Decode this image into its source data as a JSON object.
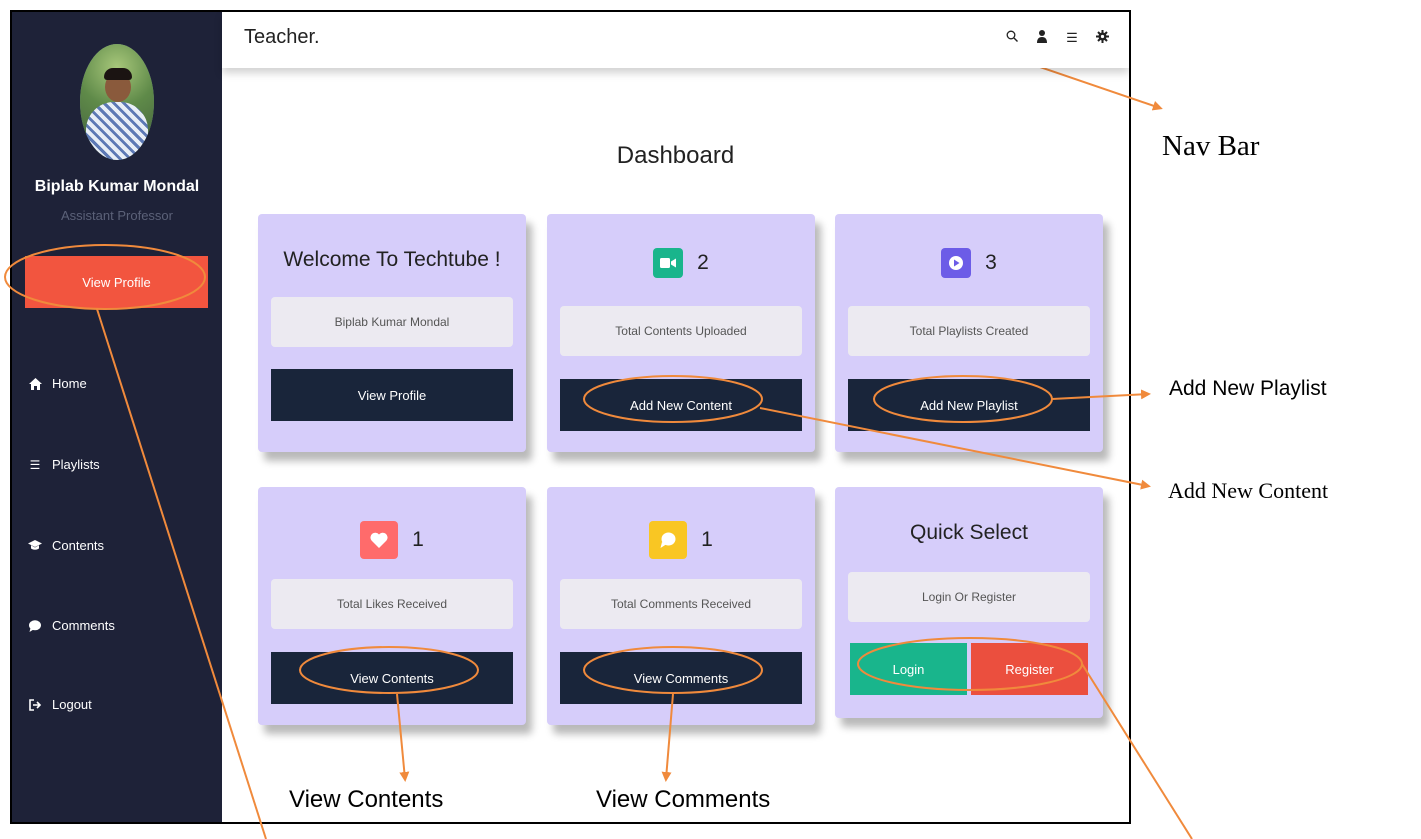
{
  "app": {
    "brand": "Teacher.",
    "page_title": "Dashboard",
    "profile": {
      "name": "Biplab Kumar Mondal",
      "role": "Assistant Professor",
      "button": "View Profile"
    },
    "sidebar": {
      "items": [
        {
          "label": "Home",
          "icon": "home-icon"
        },
        {
          "label": "Playlists",
          "icon": "list-icon"
        },
        {
          "label": "Contents",
          "icon": "graduation-cap-icon"
        },
        {
          "label": "Comments",
          "icon": "comment-icon"
        },
        {
          "label": "Logout",
          "icon": "logout-icon"
        }
      ]
    },
    "topbar_icons": [
      "search-icon",
      "user-icon",
      "menu-icon",
      "settings-icon"
    ],
    "cards": {
      "welcome": {
        "title": "Welcome To Techtube !",
        "field": "Biplab Kumar Mondal",
        "button": "View Profile"
      },
      "contents": {
        "count": "2",
        "field": "Total Contents Uploaded",
        "button": "Add New Content",
        "icon_color": "#19b58c"
      },
      "playlists": {
        "count": "3",
        "field": "Total Playlists Created",
        "button": "Add New Playlist",
        "icon_color": "#6c5ce7"
      },
      "likes": {
        "count": "1",
        "field": "Total Likes Received",
        "button": "View Contents",
        "icon_color": "#ff6b6b"
      },
      "comments": {
        "count": "1",
        "field": "Total Comments Received",
        "button": "View Comments",
        "icon_color": "#f9c623"
      },
      "quick": {
        "title": "Quick Select",
        "field": "Login Or Register",
        "login": "Login",
        "register": "Register"
      }
    }
  },
  "annotations": {
    "nav_bar": "Nav Bar",
    "add_new_playlist": "Add New Playlist",
    "add_new_content": "Add New Content",
    "view_contents": "View Contents",
    "view_comments": "View Comments"
  },
  "colors": {
    "sidebar": "#1e2238",
    "card": "#d6cdfa",
    "dark_button": "#19253a",
    "accent_red": "#f2553f",
    "annotation": "#f08a3c"
  }
}
